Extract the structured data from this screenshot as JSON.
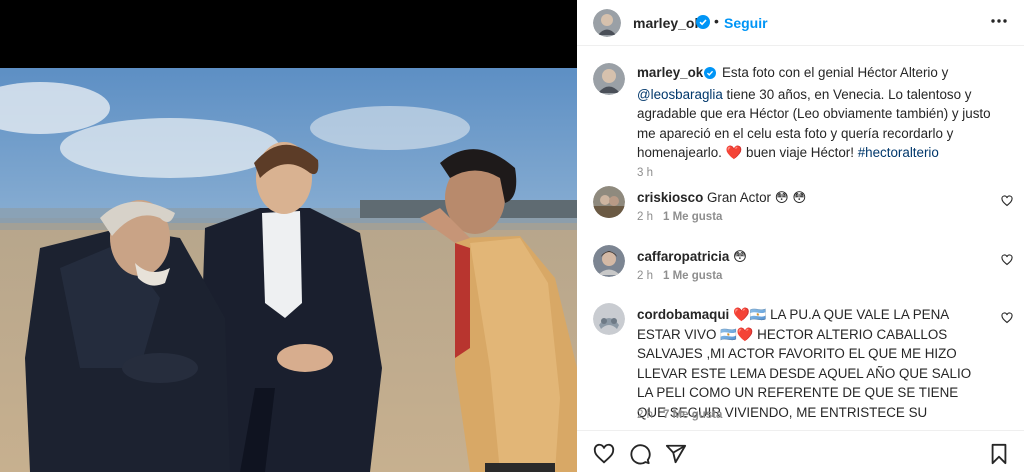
{
  "post": {
    "username": "marley_ok",
    "separator": "•",
    "follow_label": "Seguir",
    "caption": {
      "username": "marley_ok",
      "text_part1": "Esta foto con el genial Héctor Alterio y",
      "mention": "@leosbaraglia",
      "text_part2": "tiene 30 años, en Venecia. Lo talentoso y agradable que era Héctor (Leo obviamente también) y justo me apareció en el celu esta foto y quería recordarlo y homenajearlo.",
      "heart": "❤️",
      "text_part3": "buen viaje Héctor!",
      "hashtag": "#hectoralterio",
      "time": "3 h"
    }
  },
  "comments": [
    {
      "username": "criskiosco",
      "text": "Gran Actor 😳 😳",
      "time": "2 h",
      "likes": "1 Me gusta"
    },
    {
      "username": "caffaropatricia",
      "text": "😳",
      "time": "2 h",
      "likes": "1 Me gusta"
    },
    {
      "username": "cordobamaqui",
      "line1": "❤️🇦🇷 LA PU.A QUE VALE LA PENA ESTAR VIVO",
      "line2": "🇦🇷❤️  HECTOR ALTERIO CABALLOS SALVAJES ,MI ACTOR FAVORITO EL QUE ME HIZO LLEVAR ESTE LEMA DESDE AQUEL AÑO QUE SALIO LA PELI COMO UN REFERENTE DE QUE SE TIENE QUE SEGUIR VIVIENDO, ME ENTRISTECE SU PARTIDA GRAN ACTOR 💐 ❤️🇦🇷❤️",
      "time": "2 h",
      "likes": "7 Me gusta"
    }
  ],
  "icons": {
    "header": [
      "verified-badge-icon",
      "more-options-icon"
    ],
    "actions": [
      "heart-icon",
      "comment-icon",
      "share-icon",
      "bookmark-icon"
    ],
    "comment_like": "heart-outline-icon"
  },
  "colors": {
    "link_blue": "#0095f6",
    "mention_blue": "#00376b",
    "muted_gray": "#8e8e8e",
    "heart_red": "#ed4956"
  }
}
